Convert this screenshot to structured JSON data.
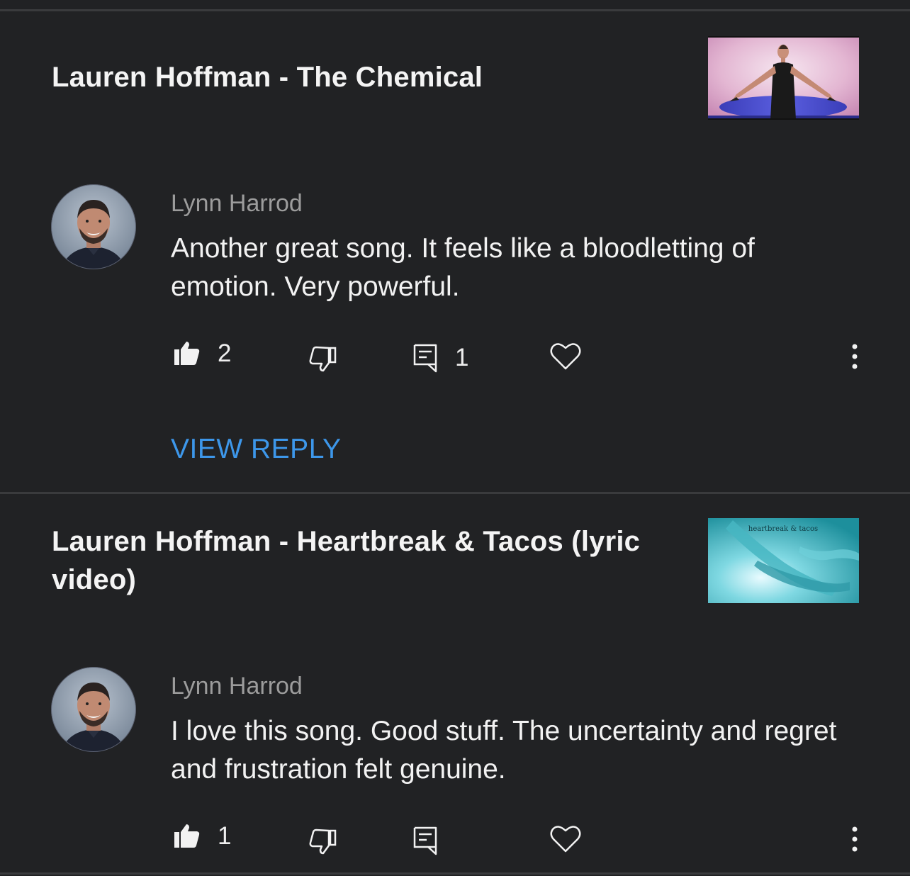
{
  "items": [
    {
      "video_title": "Lauren Hoffman - The Chemical",
      "thumbnail_caption": "",
      "author": "Lynn Harrod",
      "comment": "Another great song. It feels like a bloodletting of emotion. Very powerful.",
      "like_count": "2",
      "reply_count": "1",
      "view_reply_label": "VIEW REPLY"
    },
    {
      "video_title": "Lauren Hoffman - Heartbreak & Tacos (lyric video)",
      "thumbnail_caption": "heartbreak & tacos",
      "author": "Lynn Harrod",
      "comment": "I love this song. Good stuff. The uncertainty and regret and frustration felt genuine.",
      "like_count": "1",
      "reply_count": ""
    }
  ],
  "icons": {
    "like": "thumbs-up-filled-icon",
    "dislike": "thumbs-down-outline-icon",
    "reply": "comment-reply-icon",
    "heart": "heart-outline-icon",
    "more": "vertical-ellipsis-icon"
  },
  "colors": {
    "background": "#212224",
    "link": "#3d97ea",
    "author": "#9c9c9c",
    "text": "#f2f2f2"
  }
}
